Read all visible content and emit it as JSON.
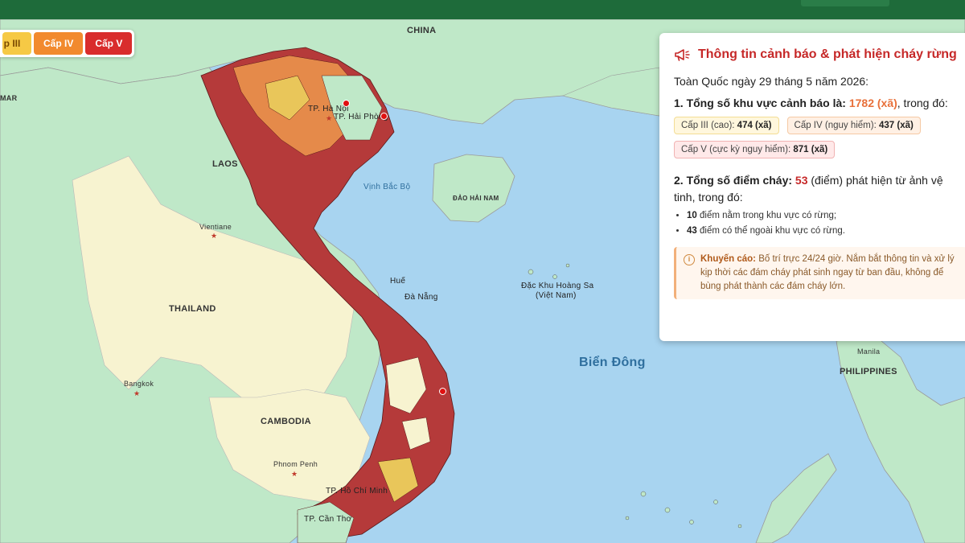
{
  "legend": {
    "iii_label": "p III",
    "iv_label": "Cấp IV",
    "v_label": "Cấp V"
  },
  "colors": {
    "header": "#1e6b3a",
    "land": "#bfe8c8",
    "sea": "#a8d4f0",
    "level_iii": "#f6c945",
    "level_iv": "#f28a2e",
    "level_v": "#d92c2c",
    "fire_point": "#e01010"
  },
  "map_labels": {
    "china": "CHINA",
    "myanmar": "MAR",
    "laos": "LAOS",
    "thailand": "THAILAND",
    "cambodia": "CAMBODIA",
    "philippines": "PHILIPPINES",
    "hainan": "ĐẢO HẢI NAM",
    "gulf": "Vịnh Bắc Bộ",
    "east_sea": "Biển Đông",
    "paracel_1": "Đặc Khu Hoàng Sa",
    "paracel_2": "(Việt Nam)",
    "vientiane": "Vientiane",
    "bangkok": "Bangkok",
    "phnom_penh": "Phnom Penh",
    "manila": "Manila",
    "hanoi": "TP. Hà Nội",
    "haiphong": "TP. Hải Phòng",
    "hue": "Huế",
    "danang": "Đà Nẵng",
    "hcm": "TP. Hồ Chí Minh",
    "cantho": "TP. Cần Thơ"
  },
  "panel": {
    "title": "Thông tin cảnh báo & phát hiện cháy rừng",
    "title_icon": "megaphone-icon",
    "date": "Toàn Quốc ngày 29 tháng 5 năm 2026:",
    "warning_heading": "1. Tổng số khu vực cảnh báo là:",
    "warning_total": "1782 (xã)",
    "warning_suffix": ", trong đó:",
    "badge_iii_label": "Cấp III (cao):",
    "badge_iii_value": "474 (xã)",
    "badge_iv_label": "Cấp IV (nguy hiểm):",
    "badge_iv_value": "437 (xã)",
    "badge_v_label": "Cấp V (cực kỳ nguy hiểm):",
    "badge_v_value": "871 (xã)",
    "fire_heading": "2. Tổng số điểm cháy:",
    "fire_total": "53",
    "fire_suffix": " (điểm) phát hiện từ ảnh vệ tinh, trong đó:",
    "bullet_1_value": "10",
    "bullet_1_text": " điểm nằm trong khu vực có rừng;",
    "bullet_2_value": "43",
    "bullet_2_text": " điểm có thể ngoài khu vực có rừng.",
    "advice_label": "Khuyến cáo:",
    "advice_text": " Bố trí trực 24/24 giờ. Nắm bắt thông tin và xử lý kịp thời các đám cháy phát sinh ngay từ ban đầu, không để bùng phát thành các đám cháy lớn."
  }
}
